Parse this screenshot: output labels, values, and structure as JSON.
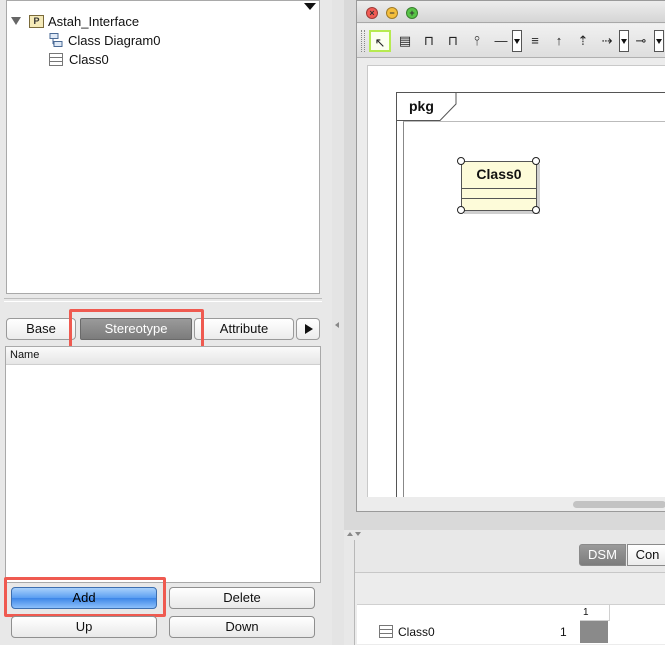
{
  "tree": {
    "root_label": "Astah_Interface",
    "items": [
      {
        "label": "Class Diagram0",
        "icon": "class-diagram-icon"
      },
      {
        "label": "Class0",
        "icon": "class-icon"
      }
    ]
  },
  "tabs": [
    {
      "label": "Base",
      "selected": false
    },
    {
      "label": "Stereotype",
      "selected": true
    },
    {
      "label": "Attribute",
      "selected": false
    }
  ],
  "stereotype_list": {
    "column_header": "Name",
    "rows": []
  },
  "buttons": {
    "add": "Add",
    "delete": "Delete",
    "up": "Up",
    "down": "Down"
  },
  "diagram": {
    "package_label": "pkg",
    "class_name": "Class0"
  },
  "window_controls": {
    "close": "×",
    "minimize": "−",
    "zoom": "+"
  },
  "toolbar_glyphs": {
    "select": "↖",
    "class": "▤",
    "package": "⊓",
    "subsystem": "⊓",
    "interface": "⫯",
    "association": "—",
    "aggregation": "≡",
    "generalization": "↑",
    "realization": "⇡",
    "dependency": "⇢",
    "usage": "⊸"
  },
  "bottom_tabs": [
    {
      "label": "DSM",
      "selected": true
    },
    {
      "label": "Con",
      "selected": false
    }
  ],
  "dsm": {
    "header": "1",
    "row_label": "Class0",
    "row_index": "1"
  },
  "colors": {
    "highlight": "#ef5a50",
    "class_fill": "#fdfbd9",
    "primary_button": "#3e86e8",
    "selected_tab": "#8a8a8a"
  }
}
